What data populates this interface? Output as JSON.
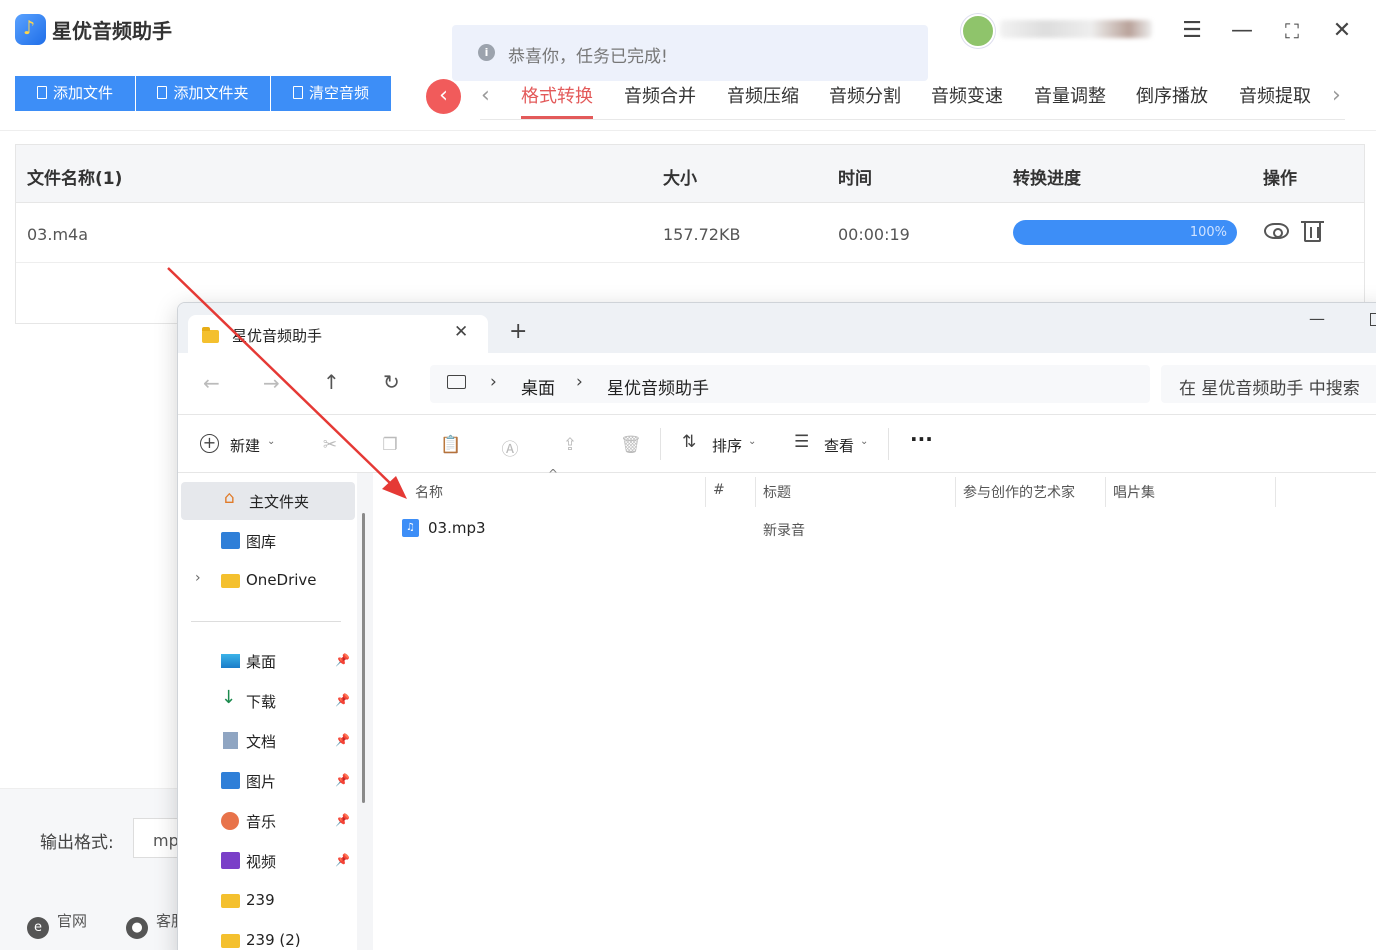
{
  "app": {
    "title": "星优音频助手",
    "toast": "恭喜你，任务已完成!",
    "toolbar": {
      "add_file": "添加文件",
      "add_folder": "添加文件夹",
      "clear": "清空音频"
    },
    "tabs": [
      "格式转换",
      "音频合并",
      "音频压缩",
      "音频分割",
      "音频变速",
      "音量调整",
      "倒序播放",
      "音频提取"
    ],
    "active_tab": "格式转换",
    "table": {
      "headers": {
        "name": "文件名称(1)",
        "size": "大小",
        "time": "时间",
        "progress": "转换进度",
        "ops": "操作"
      },
      "rows": [
        {
          "name": "03.m4a",
          "size": "157.72KB",
          "time": "00:00:19",
          "progress_label": "100%",
          "progress": 1.0
        }
      ]
    },
    "output": {
      "label": "输出格式:",
      "value": "mp"
    },
    "footer": {
      "site": "官网",
      "service": "客服"
    }
  },
  "explorer": {
    "tab_title": "星优音频助手",
    "breadcrumb": [
      "桌面",
      "星优音频助手"
    ],
    "search_placeholder": "在 星优音频助手 中搜索",
    "commands": {
      "new": "新建",
      "sort": "排序",
      "view": "查看"
    },
    "sidebar": [
      {
        "label": "主文件夹",
        "icon": "home-icon"
      },
      {
        "label": "图库",
        "icon": "gallery-icon"
      },
      {
        "label": "OneDrive",
        "icon": "folder-icon"
      },
      {
        "label": "桌面",
        "icon": "desktop-icon"
      },
      {
        "label": "下载",
        "icon": "download-icon"
      },
      {
        "label": "文档",
        "icon": "document-icon"
      },
      {
        "label": "图片",
        "icon": "pictures-icon"
      },
      {
        "label": "音乐",
        "icon": "music-icon"
      },
      {
        "label": "视频",
        "icon": "video-icon"
      },
      {
        "label": "239",
        "icon": "folder-icon"
      },
      {
        "label": "239 (2)",
        "icon": "folder-icon"
      }
    ],
    "columns": [
      "名称",
      "#",
      "标题",
      "参与创作的艺术家",
      "唱片集"
    ],
    "files": [
      {
        "name": "03.mp3",
        "title": "新录音"
      }
    ]
  },
  "colors": {
    "accent": "#3d8ef7",
    "active_tab": "#e35a5a",
    "arrow": "#e53935"
  }
}
